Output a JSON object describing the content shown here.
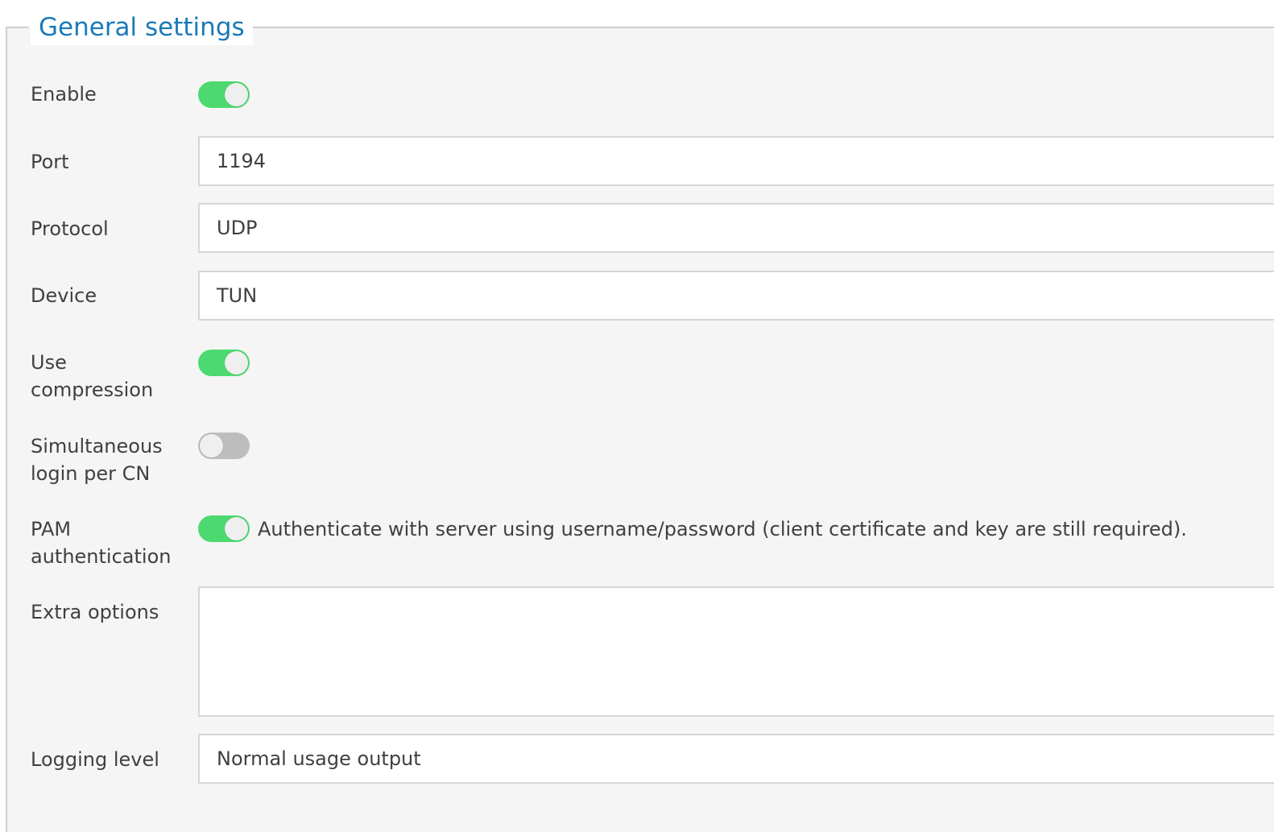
{
  "section": {
    "title": "General settings"
  },
  "fields": {
    "enable": {
      "label": "Enable",
      "state": "on"
    },
    "port": {
      "label": "Port",
      "value": "1194"
    },
    "protocol": {
      "label": "Protocol",
      "value": "UDP"
    },
    "device": {
      "label": "Device",
      "value": "TUN"
    },
    "use_compression": {
      "label_line1": "Use",
      "label_line2": "compression",
      "state": "on"
    },
    "simultaneous_login": {
      "label_line1": "Simultaneous",
      "label_line2": "login per CN",
      "state": "off"
    },
    "pam_auth": {
      "label_line1": "PAM",
      "label_line2": "authentication",
      "state": "on",
      "help": "Authenticate with server using username/password (client certificate and key are still required)."
    },
    "extra_options": {
      "label": "Extra options",
      "value": ""
    },
    "logging_level": {
      "label": "Logging level",
      "value": "Normal usage output"
    }
  },
  "colors": {
    "accent": "#1a7ab8",
    "toggle_on": "#4cd96f",
    "toggle_off": "#bdbdbd"
  }
}
